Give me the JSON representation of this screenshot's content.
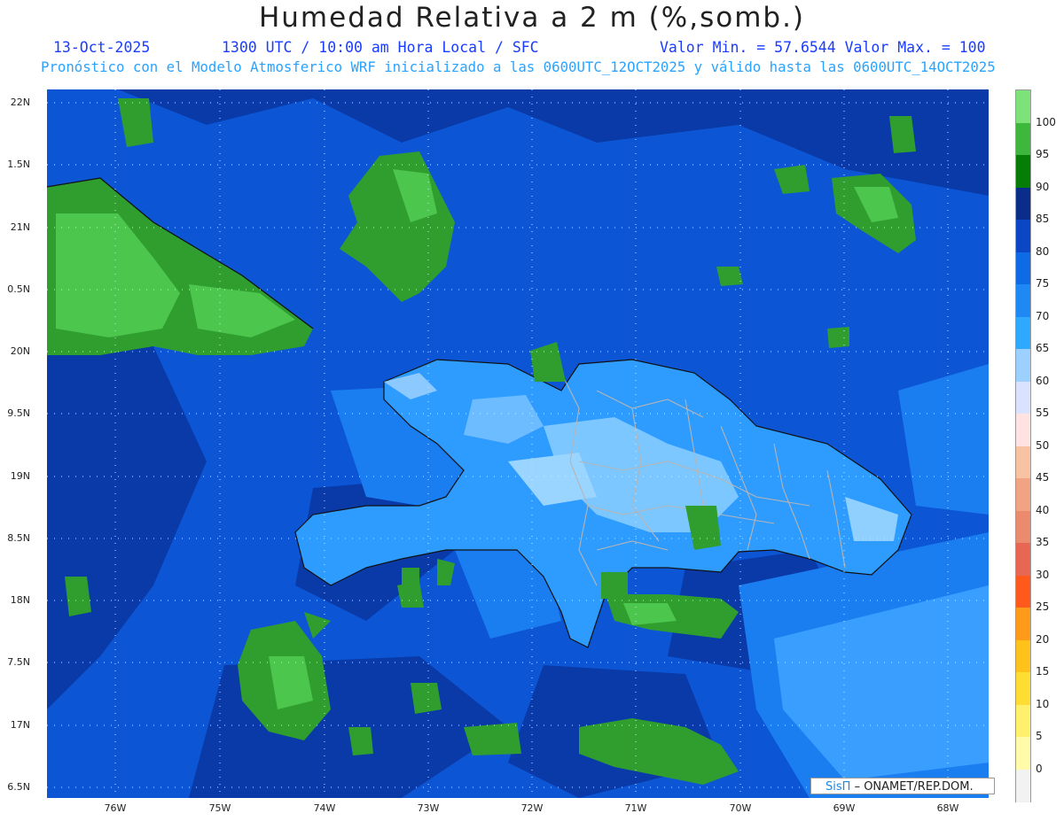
{
  "header": {
    "title": "Humedad Relativa a 2 m (%,somb.)",
    "date": "13-Oct-2025",
    "time": "1300 UTC / 10:00 am Hora Local / SFC",
    "minmax": "Valor Min. = 57.6544  Valor Max. = 100",
    "model_line": "Pronóstico con el Modelo Atmosferico WRF inicializado a las 0600UTC_12OCT2025 y válido hasta las  0600UTC_14OCT2025"
  },
  "axes": {
    "y_labels": [
      "22N",
      "1.5N",
      "21N",
      "0.5N",
      "20N",
      "9.5N",
      "19N",
      "8.5N",
      "18N",
      "7.5N",
      "17N",
      "6.5N"
    ],
    "x_labels": [
      "76W",
      "75W",
      "74W",
      "73W",
      "72W",
      "71W",
      "70W",
      "69W",
      "68W"
    ]
  },
  "legend": {
    "labels": [
      "100",
      "95",
      "90",
      "85",
      "80",
      "75",
      "70",
      "65",
      "60",
      "55",
      "50",
      "45",
      "40",
      "35",
      "30",
      "25",
      "20",
      "15",
      "10",
      "5",
      "0"
    ],
    "colors": [
      "#7de27a",
      "#3db83d",
      "#067d06",
      "#0a2d8c",
      "#0b46c4",
      "#0f6ae6",
      "#1e88f5",
      "#2ea9ff",
      "#9bd0ff",
      "#d9e3ff",
      "#ffe3e3",
      "#f7c3a3",
      "#f2a383",
      "#ec8a6e",
      "#e86752",
      "#ff5a1c",
      "#ff9a1a",
      "#ffc21a",
      "#ffdd33",
      "#fff06e",
      "#fffba8",
      "#f2f2f2"
    ]
  },
  "credit": {
    "sis": "SisΠ",
    "text": "– ONAMET/REP.DOM."
  }
}
